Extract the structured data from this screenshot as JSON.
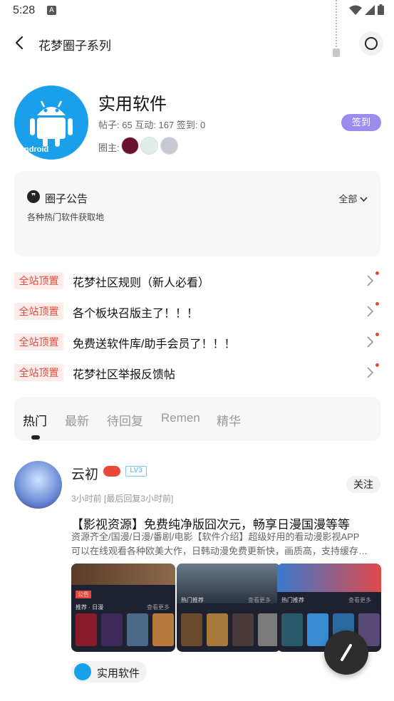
{
  "status_bar": {
    "time": "5:28",
    "notif_icon": "A"
  },
  "toolbar": {
    "title": "花梦圈子系列"
  },
  "group": {
    "name": "实用软件",
    "stats": "帖子: 65 互动: 167 签到: 0",
    "owner_label": "圈主:",
    "signin_label": "签到",
    "logo_text": "ndroid"
  },
  "notice": {
    "title": "圈子公告",
    "all_label": "全部",
    "text": "各种热门软件获取地"
  },
  "pinned": [
    {
      "tag": "全站顶置",
      "text": "花梦社区规则（新人必看）"
    },
    {
      "tag": "全站顶置",
      "text": "各个板块召版主了！！！"
    },
    {
      "tag": "全站顶置",
      "text": "免费送软件库/助手会员了！！！"
    },
    {
      "tag": "全站顶置",
      "text": "花梦社区举报反馈帖"
    }
  ],
  "tabs": [
    {
      "label": "热门"
    },
    {
      "label": "最新"
    },
    {
      "label": "待回复"
    },
    {
      "label": "Remen"
    },
    {
      "label": "精华"
    }
  ],
  "post": {
    "author": "云初",
    "level": "LV3",
    "time": "3小时前 [最后回复3小时前]",
    "follow_label": "关注",
    "title": "【影视资源】免费纯净版囧次元，畅享日漫国漫等等",
    "body_line1": "资源齐全/国漫/日漫/番剧/电影【软件介绍】超级好用的看动漫影视APP",
    "body_line2": "可以在线观看各种欧美大作，日韩动漫免费更新快，画质高，支持缓存…",
    "tag": "实用软件",
    "screenshots": [
      {
        "row1": "公告",
        "row2": "推荐 · 日漫",
        "more": "查看更多"
      },
      {
        "row1": "热门推荐",
        "row2": "",
        "more": "查看更多"
      },
      {
        "row1": "热门推荐",
        "row2": "",
        "more": "查看更多"
      }
    ]
  },
  "colors": {
    "accent_purple": "#9b8cf0",
    "pin_red": "#e8473a",
    "logo_blue": "#1aa0ea"
  }
}
